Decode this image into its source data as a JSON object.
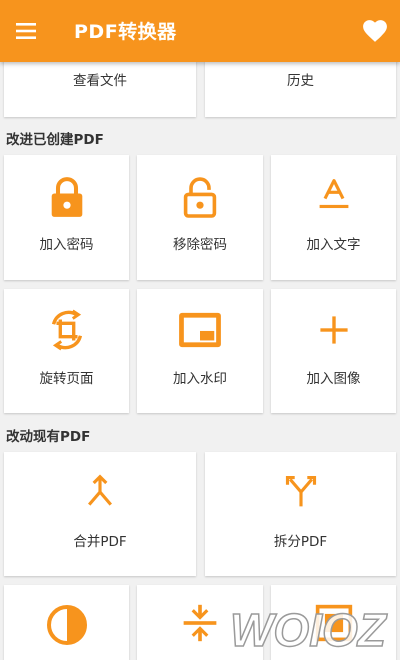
{
  "app": {
    "title": "PDF转换器",
    "accent_color": "#f7941d",
    "icons": {
      "menu": "hamburger-menu-icon",
      "favorite": "heart-icon"
    }
  },
  "top_cards": [
    {
      "label": "查看文件"
    },
    {
      "label": "历史"
    }
  ],
  "sections": {
    "create_title": "改进已创建PDF",
    "modify_title": "改动现有PDF"
  },
  "create_cards": [
    {
      "label": "加入密码",
      "icon": "lock-icon"
    },
    {
      "label": "移除密码",
      "icon": "unlock-icon"
    },
    {
      "label": "加入文字",
      "icon": "text-format-icon"
    },
    {
      "label": "旋转页面",
      "icon": "rotate-crop-icon"
    },
    {
      "label": "加入水印",
      "icon": "watermark-icon"
    },
    {
      "label": "加入图像",
      "icon": "add-plus-icon"
    }
  ],
  "modify_cards": [
    {
      "label": "合并PDF",
      "icon": "merge-icon"
    },
    {
      "label": "拆分PDF",
      "icon": "split-icon"
    }
  ],
  "bottom_cards": [
    {
      "icon": "contrast-icon"
    },
    {
      "icon": "compress-icon"
    },
    {
      "icon": "image-frame-icon"
    }
  ],
  "watermark": {
    "text": "WOIOZ"
  }
}
